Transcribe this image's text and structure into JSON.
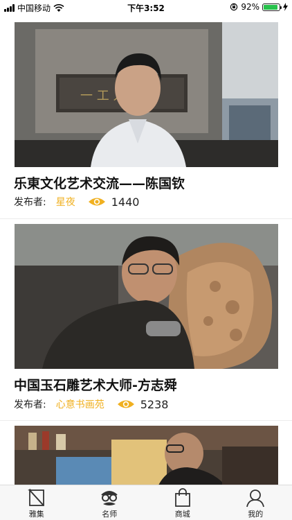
{
  "status_bar": {
    "carrier": "中国移动",
    "time": "下午3:52",
    "battery_percent": "92%",
    "battery_level": 0.92
  },
  "feed": {
    "cards": [
      {
        "title": "乐東文化艺术交流——陈国钦",
        "author_label": "发布者:",
        "author": "星夜",
        "views": "1440"
      },
      {
        "title": "中国玉石雕艺术大师-方志舜",
        "author_label": "发布者:",
        "author": "心意书画苑",
        "views": "5238"
      }
    ]
  },
  "tabbar": {
    "tabs": [
      {
        "label": "雅集",
        "icon": "pen-note-icon",
        "active": false
      },
      {
        "label": "名师",
        "icon": "master-face-icon",
        "active": true
      },
      {
        "label": "商城",
        "icon": "shopping-bag-icon",
        "active": false
      },
      {
        "label": "我的",
        "icon": "user-icon",
        "active": false
      }
    ]
  },
  "colors": {
    "accent": "#f0b020",
    "battery": "#27c24c"
  }
}
